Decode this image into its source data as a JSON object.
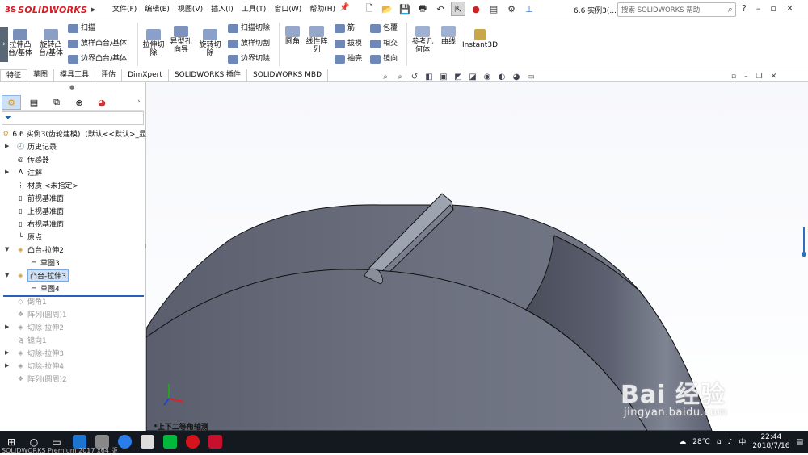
{
  "app": {
    "logo_prefix": "3S",
    "logo_text": "SOLIDWORKS"
  },
  "menus": [
    "文件(F)",
    "编辑(E)",
    "视图(V)",
    "插入(I)",
    "工具(T)",
    "窗口(W)",
    "帮助(H)"
  ],
  "document_title": "6.6 实例3(...",
  "search": {
    "placeholder": "搜索 SOLIDWORKS 帮助"
  },
  "ribbon": {
    "extrude_boss": "拉伸凸\n台/基体",
    "revolve_boss": "旋转凸\n台/基体",
    "sweep": "扫描",
    "loft": "放样凸台/基体",
    "boundary": "边界凸台/基体",
    "extrude_cut": "拉伸切\n除",
    "hole_wizard": "异型孔\n向导",
    "revolve_cut": "旋转切\n除",
    "sweep_cut": "扫描切除",
    "loft_cut": "放样切割",
    "boundary_cut": "边界切除",
    "fillet": "圆角",
    "linear_pattern": "线性阵\n列",
    "rib": "筋",
    "draft": "拔模",
    "shell": "抽壳",
    "wrap": "包覆",
    "intersect": "相交",
    "mirror": "镜向",
    "ref_geometry": "参考几\n何体",
    "curves": "曲线",
    "instant3d": "Instant3D"
  },
  "tabs": [
    "特征",
    "草图",
    "模具工具",
    "评估",
    "DimXpert",
    "SOLIDWORKS 插件",
    "SOLIDWORKS MBD"
  ],
  "tree": {
    "root": "6.6 实例3(齿轮建模)",
    "root_config": "(默认<<默认>_显",
    "items": [
      {
        "label": "历史记录",
        "state": "normal"
      },
      {
        "label": "传感器",
        "state": "normal"
      },
      {
        "label": "注解",
        "state": "normal"
      },
      {
        "label": "材质 <未指定>",
        "state": "normal"
      },
      {
        "label": "前视基准面",
        "state": "normal"
      },
      {
        "label": "上视基准面",
        "state": "normal"
      },
      {
        "label": "右视基准面",
        "state": "normal"
      },
      {
        "label": "原点",
        "state": "normal"
      },
      {
        "label": "凸台-拉伸2",
        "state": "normal"
      },
      {
        "label": "草图3",
        "state": "child"
      },
      {
        "label": "凸台-拉伸3",
        "state": "selected"
      },
      {
        "label": "草图4",
        "state": "child"
      },
      {
        "label": "倒角1",
        "state": "suppressed"
      },
      {
        "label": "阵列(圆周)1",
        "state": "suppressed"
      },
      {
        "label": "切除-拉伸2",
        "state": "suppressed"
      },
      {
        "label": "镜向1",
        "state": "suppressed"
      },
      {
        "label": "切除-拉伸3",
        "state": "suppressed"
      },
      {
        "label": "切除-拉伸4",
        "state": "suppressed"
      },
      {
        "label": "阵列(圆周)2",
        "state": "suppressed"
      }
    ]
  },
  "viewport": {
    "orientation_label": "*上下二等角轴测"
  },
  "status": {
    "text": "SOLIDWORKS Premium 2017 x64 版"
  },
  "taskbar": {
    "weather": "28℃",
    "lang": "中",
    "time": "22:44",
    "date": "2018/7/16"
  },
  "watermark": {
    "brand": "Bai 经验",
    "url": "jingyan.baidu.com"
  },
  "colors": {
    "body_dark": "#4a4d5a",
    "body_mid": "#5e6271",
    "body_light": "#7f8493",
    "accent_blue": "#2a5fbf"
  }
}
